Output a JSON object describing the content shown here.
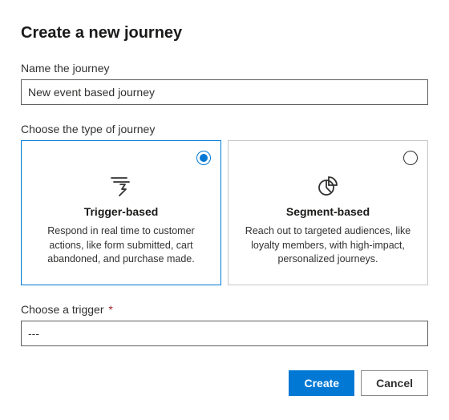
{
  "title": "Create a new journey",
  "name_field": {
    "label": "Name the journey",
    "value": "New event based journey"
  },
  "type_field": {
    "label": "Choose the type of journey",
    "options": [
      {
        "title": "Trigger-based",
        "desc": "Respond in real time to customer actions, like form submitted, cart abandoned, and purchase made.",
        "selected": true
      },
      {
        "title": "Segment-based",
        "desc": "Reach out to targeted audiences, like loyalty members, with high-impact, personalized journeys.",
        "selected": false
      }
    ]
  },
  "trigger_field": {
    "label": "Choose a trigger",
    "required_mark": "*",
    "value": "---"
  },
  "buttons": {
    "create": "Create",
    "cancel": "Cancel"
  }
}
